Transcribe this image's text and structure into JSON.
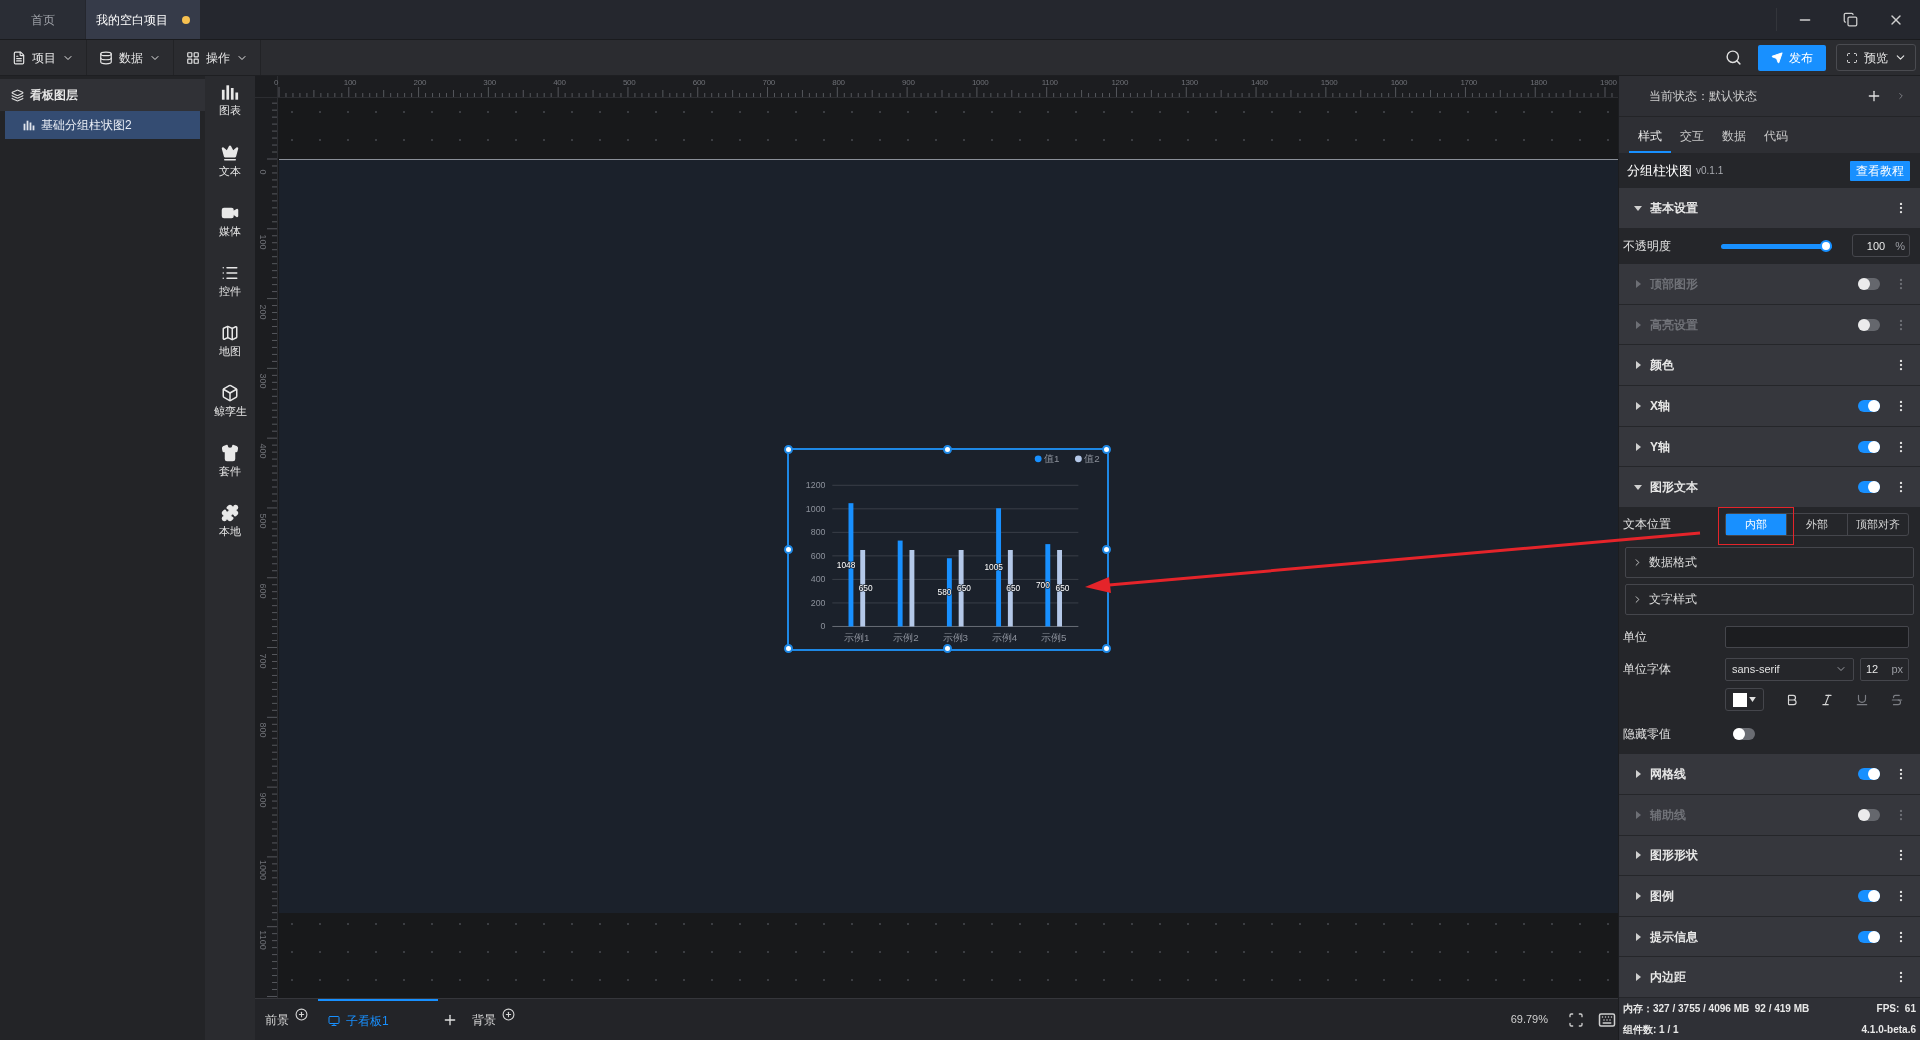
{
  "tabs": [
    {
      "label": "首页",
      "selected": false,
      "modified": false
    },
    {
      "label": "我的空白项目",
      "selected": true,
      "modified": true
    }
  ],
  "menus": [
    {
      "label": "项目",
      "kind": "file"
    },
    {
      "label": "数据",
      "kind": "database"
    },
    {
      "label": "操作",
      "kind": "grid"
    }
  ],
  "toolbar": {
    "publish": "发布",
    "preview": "预览"
  },
  "layers": {
    "title": "看板图层",
    "items": [
      {
        "label": "基础分组柱状图2",
        "selected": true
      }
    ]
  },
  "components": [
    {
      "label": "图表",
      "kind": "chart"
    },
    {
      "label": "文本",
      "kind": "text"
    },
    {
      "label": "媒体",
      "kind": "media"
    },
    {
      "label": "控件",
      "kind": "control"
    },
    {
      "label": "地图",
      "kind": "map"
    },
    {
      "label": "鲸孪生",
      "kind": "twin"
    },
    {
      "label": "套件",
      "kind": "kit"
    },
    {
      "label": "本地",
      "kind": "local"
    }
  ],
  "rulers": {
    "horizontal": [
      "0",
      "100",
      "200",
      "300",
      "400",
      "500",
      "600",
      "700",
      "800",
      "900",
      "1000",
      "1100",
      "1200",
      "1300",
      "1400",
      "1500",
      "1600",
      "1700",
      "1800",
      "1900"
    ],
    "vertical": [
      "0",
      "100",
      "200",
      "300",
      "400",
      "500",
      "600",
      "700",
      "800",
      "900",
      "1000",
      "1100"
    ]
  },
  "widget": {
    "selected": true,
    "chart_data": {
      "type": "bar",
      "categories": [
        "示例1",
        "示例2",
        "示例3",
        "示例4",
        "示例5"
      ],
      "series": [
        {
          "name": "值1",
          "color": "#1890ff",
          "values": [
            1048,
            730,
            580,
            1005,
            700
          ]
        },
        {
          "name": "值2",
          "color": "#b4c8e8",
          "values": [
            650,
            650,
            650,
            650,
            650
          ]
        }
      ],
      "grid": true,
      "legend": true,
      "ylim": [
        0,
        1200
      ],
      "yticks": [
        0,
        200,
        400,
        600,
        800,
        1000,
        1200
      ],
      "value_labels": [
        [
          "1048",
          null,
          "580",
          "1005",
          "700"
        ],
        [
          "650",
          null,
          "650",
          "650",
          "650"
        ]
      ]
    }
  },
  "panel": {
    "state_label": "当前状态：默认状态",
    "tabs": [
      {
        "label": "样式",
        "selected": true
      },
      {
        "label": "交互",
        "selected": false
      },
      {
        "label": "数据",
        "selected": false
      },
      {
        "label": "代码",
        "selected": false
      }
    ],
    "component_title": "分组柱状图",
    "version": "v0.1.1",
    "tutorial_button": "查看教程",
    "items": [
      {
        "kind": "section",
        "label": "基本设置",
        "expanded": true,
        "disabled": false
      },
      {
        "kind": "slider",
        "label": "不透明度",
        "level": 1,
        "value": "100",
        "unit": "%"
      },
      {
        "kind": "section",
        "label": "顶部图形",
        "expanded": false,
        "disabled": true,
        "toggle": false
      },
      {
        "kind": "section",
        "label": "高亮设置",
        "expanded": false,
        "disabled": true,
        "toggle": false
      },
      {
        "kind": "section",
        "label": "颜色",
        "expanded": false,
        "disabled": false
      },
      {
        "kind": "section",
        "label": "X轴",
        "expanded": false,
        "disabled": false,
        "toggle": true
      },
      {
        "kind": "section",
        "label": "Y轴",
        "expanded": false,
        "disabled": false,
        "toggle": true
      },
      {
        "kind": "section",
        "label": "图形文本",
        "expanded": true,
        "disabled": false,
        "toggle": true
      },
      {
        "kind": "segmented",
        "label": "文本位置",
        "options": [
          {
            "label": "内部",
            "selected": true
          },
          {
            "label": "外部",
            "selected": false
          },
          {
            "label": "顶部对齐",
            "selected": false
          }
        ]
      },
      {
        "kind": "group",
        "label": "数据格式",
        "expanded": false
      },
      {
        "kind": "group",
        "label": "文字样式",
        "expanded": false
      },
      {
        "kind": "input",
        "label": "单位"
      },
      {
        "kind": "font",
        "label": "单位字体",
        "font": "sans-serif",
        "size": "12",
        "unit": "px"
      },
      {
        "kind": "text-style"
      },
      {
        "kind": "switch",
        "label": "隐藏零值",
        "on": false
      },
      {
        "kind": "section",
        "label": "网格线",
        "expanded": false,
        "disabled": false,
        "toggle": true
      },
      {
        "kind": "section",
        "label": "辅助线",
        "expanded": false,
        "disabled": true,
        "toggle": false
      },
      {
        "kind": "section",
        "label": "图形形状",
        "expanded": false,
        "disabled": false
      },
      {
        "kind": "section",
        "label": "图例",
        "expanded": false,
        "disabled": false,
        "toggle": true
      },
      {
        "kind": "section",
        "label": "提示信息",
        "expanded": false,
        "disabled": false,
        "toggle": true
      },
      {
        "kind": "section",
        "label": "内边距",
        "expanded": false,
        "disabled": false
      }
    ]
  },
  "bottom": {
    "tabs": [
      {
        "label": "前景",
        "kind": "layer",
        "selected": false
      },
      {
        "label": "子看板1",
        "kind": "board",
        "selected": true
      },
      {
        "label": "背景",
        "kind": "layer",
        "selected": false
      }
    ],
    "zoom": "69.79%"
  },
  "status": {
    "memory": "内存：327 / 3755 / 4096 MB  92 / 419 MB",
    "fps": "FPS:  61",
    "count": "组件数: 1 / 1",
    "version": "4.1.0-beta.6"
  }
}
